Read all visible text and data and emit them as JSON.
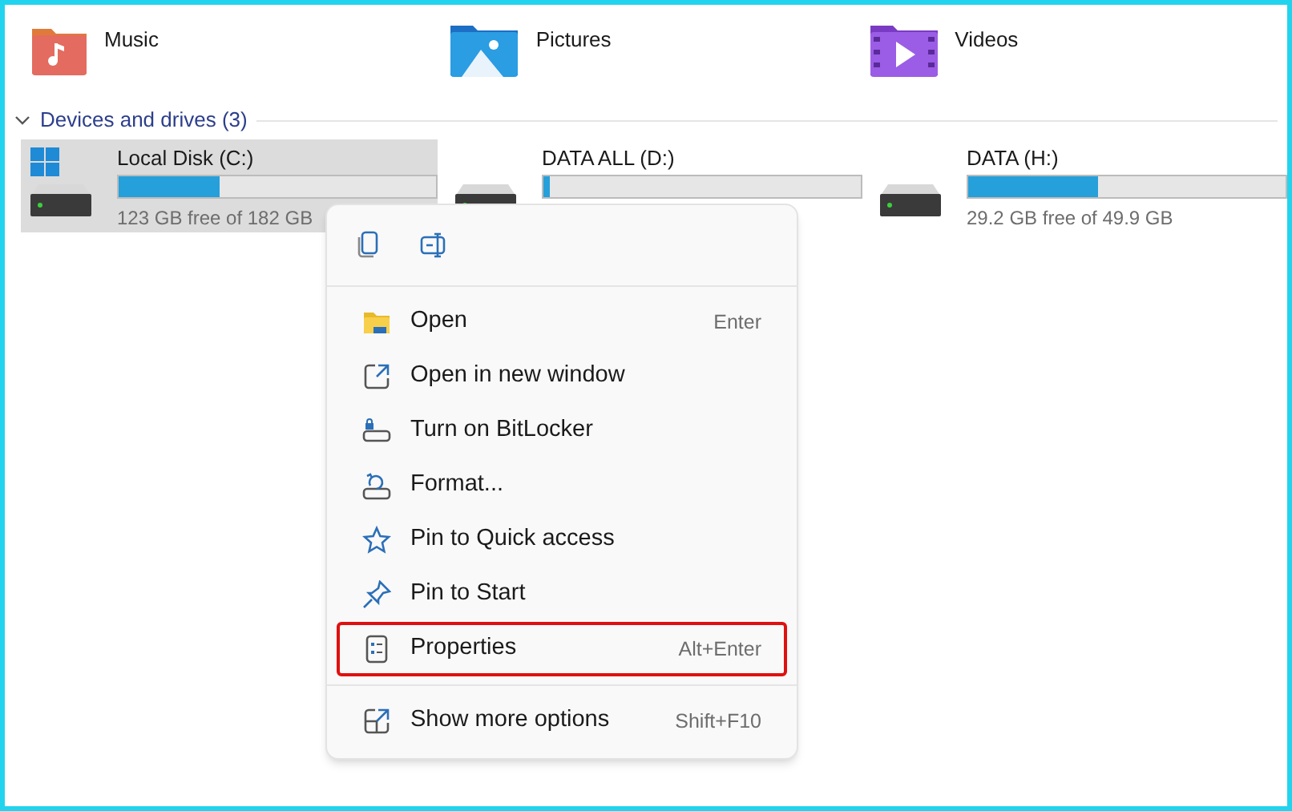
{
  "folders": [
    {
      "label": "Music"
    },
    {
      "label": "Pictures"
    },
    {
      "label": "Videos"
    }
  ],
  "section": {
    "title": "Devices and drives (3)",
    "expanded": true
  },
  "drives": [
    {
      "name": "Local Disk (C:)",
      "selected": true,
      "system": true,
      "level": 0.32,
      "free": "123 GB free of 182 GB"
    },
    {
      "name": "DATA ALL (D:)",
      "selected": false,
      "system": false,
      "level": 0.02
    },
    {
      "name": "DATA (H:)",
      "selected": false,
      "system": false,
      "level": 0.41,
      "free": "29.2 GB free of 49.9 GB"
    }
  ],
  "context_menu": {
    "groups": [
      [
        {
          "label": "Open",
          "shortcut": "Enter",
          "highlighted": false
        },
        {
          "label": "Open in new window",
          "highlighted": false
        },
        {
          "label": "Turn on BitLocker",
          "highlighted": false
        },
        {
          "label": "Format...",
          "highlighted": false
        },
        {
          "label": "Pin to Quick access",
          "highlighted": false
        },
        {
          "label": "Pin to Start",
          "highlighted": false
        },
        {
          "label": "Properties",
          "shortcut": "Alt+Enter",
          "highlighted": true
        }
      ],
      [
        {
          "label": "Show more options",
          "shortcut": "Shift+F10",
          "highlighted": false
        }
      ]
    ]
  }
}
